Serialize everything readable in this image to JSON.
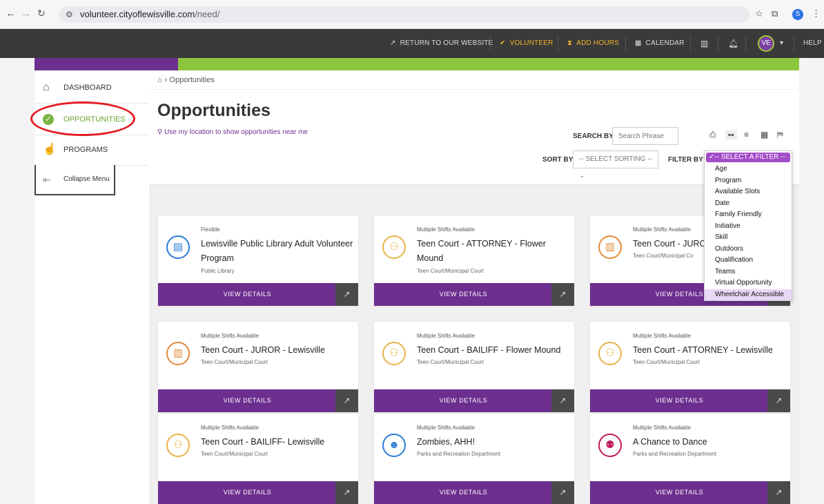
{
  "browser": {
    "url_host": "volunteer.cityoflewisville.com",
    "url_path": "/need/",
    "profile_initial": "S"
  },
  "topnav": {
    "return": "RETURN TO OUR WEBSITE",
    "volunteer": "VOLUNTEER",
    "add_hours": "ADD HOURS",
    "calendar": "CALENDAR",
    "avatar": "VE",
    "help": "HELP"
  },
  "sidebar": {
    "items": [
      {
        "label": "DASHBOARD",
        "icon": "home-icon"
      },
      {
        "label": "OPPORTUNITIES",
        "icon": "check-circle-icon"
      },
      {
        "label": "PROGRAMS",
        "icon": "hand-icon"
      }
    ],
    "collapse": "Collapse Menu"
  },
  "page": {
    "breadcrumb": "Opportunities",
    "title": "Opportunities",
    "location_link": "Use my location to show opportunities near me",
    "search_label": "SEARCH BY",
    "search_placeholder": "Search Phrase",
    "sort_label": "SORT BY",
    "sort_value": "-- SELECT SORTING --",
    "filter_label": "FILTER BY"
  },
  "filter_dropdown": {
    "selected": "-- SELECT A FILTER --",
    "options": [
      "Age",
      "Program",
      "Available Slots",
      "Date",
      "Family Friendly",
      "Initiative",
      "Skill",
      "Outdoors",
      "Qualification",
      "Teams",
      "Virtual Opportunity",
      "Wheelchair Accessible"
    ]
  },
  "cards": [
    {
      "tag": "Flexible",
      "title": "Lewisville Public Library Adult Volunteer Program",
      "org": "Public Library",
      "btn": "VIEW DETAILS",
      "color": "#2a7bd6",
      "icon": "book-icon"
    },
    {
      "tag": "Multiple Shifts Available",
      "title": "Teen Court - ATTORNEY - Flower Mound",
      "org": "Teen Court/Municipal Court",
      "btn": "VIEW DETAILS",
      "color": "#e8b34a",
      "icon": "people-icon"
    },
    {
      "tag": "Multiple Shifts Available",
      "title": "Teen Court - JURO",
      "org": "Teen Court/Municipal Co",
      "btn": "VIEW DETAILS",
      "color": "#e08a3a",
      "icon": "open-book-icon"
    },
    {
      "tag": "Multiple Shifts Available",
      "title": "Teen Court - JUROR - Lewisville",
      "org": "Teen Court/Municipal Court",
      "btn": "VIEW DETAILS",
      "color": "#e08a3a",
      "icon": "open-book-icon"
    },
    {
      "tag": "Multiple Shifts Available",
      "title": "Teen Court - BAILIFF - Flower Mound",
      "org": "Teen Court/Municipal Court",
      "btn": "VIEW DETAILS",
      "color": "#e8b34a",
      "icon": "people-icon"
    },
    {
      "tag": "Multiple Shifts Available",
      "title": "Teen Court - ATTORNEY - Lewisville",
      "org": "Teen Court/Municipal Court",
      "btn": "VIEW DETAILS",
      "color": "#e8b34a",
      "icon": "people-icon"
    },
    {
      "tag": "Multiple Shifts Available",
      "title": "Teen Court - BAILIFF- Lewisville",
      "org": "Teen Court/Municipal Court",
      "btn": "VIEW DETAILS",
      "color": "#e8b34a",
      "icon": "people-icon"
    },
    {
      "tag": "Multiple Shifts Available",
      "title": "Zombies, AHH!",
      "org": "Parks and Recreation Department",
      "btn": "VIEW DETAILS",
      "color": "#2a7bd6",
      "icon": "chat-person-icon"
    },
    {
      "tag": "Multiple Shifts Available",
      "title": "A Chance to Dance",
      "org": "Parks and Recreation Department",
      "btn": "VIEW DETAILS",
      "color": "#c2185b",
      "icon": "group-icon"
    }
  ]
}
